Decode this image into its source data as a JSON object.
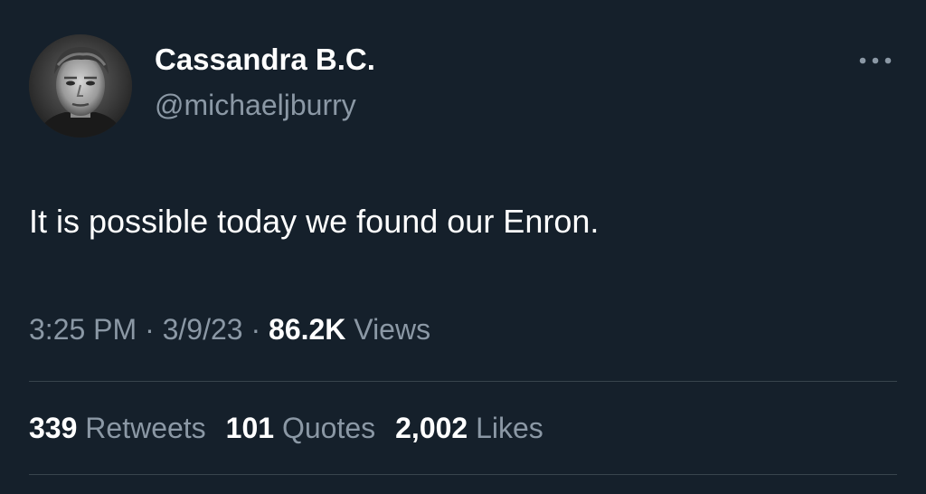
{
  "author": {
    "display_name": "Cassandra B.C.",
    "handle": "@michaeljburry"
  },
  "tweet": {
    "text": "It is possible today we found our Enron.",
    "time": "3:25 PM",
    "date": "3/9/23",
    "views_count": "86.2K",
    "views_label": "Views",
    "separator": "·"
  },
  "stats": [
    {
      "count": "339",
      "label": "Retweets"
    },
    {
      "count": "101",
      "label": "Quotes"
    },
    {
      "count": "2,002",
      "label": "Likes"
    }
  ],
  "icons": {
    "more": "more-horizontal-icon",
    "avatar": "avatar"
  },
  "colors": {
    "background": "#15202b",
    "primary_text": "#ffffff",
    "secondary_text": "#8b98a5",
    "divider": "#38444d"
  }
}
